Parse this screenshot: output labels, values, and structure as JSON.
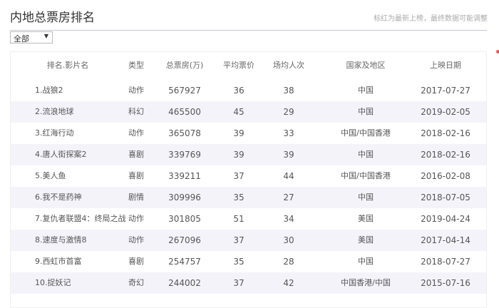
{
  "title": "内地总票房排名",
  "note": "标红为最新上榜，最终数据可能调整",
  "filter": {
    "selected": "全部"
  },
  "columns": [
    "排名.影片名",
    "类型",
    "总票房(万)",
    "平均票价",
    "场均人次",
    "国家及地区",
    "上映日期"
  ],
  "rows": [
    [
      "1.战狼2",
      "动作",
      "567927",
      "36",
      "38",
      "中国",
      "2017-07-27"
    ],
    [
      "2.流浪地球",
      "科幻",
      "465500",
      "45",
      "29",
      "中国",
      "2019-02-05"
    ],
    [
      "3.红海行动",
      "动作",
      "365078",
      "39",
      "33",
      "中国/中国香港",
      "2018-02-16"
    ],
    [
      "4.唐人街探案2",
      "喜剧",
      "339769",
      "39",
      "39",
      "中国",
      "2018-02-16"
    ],
    [
      "5.美人鱼",
      "喜剧",
      "339211",
      "37",
      "44",
      "中国/中国香港",
      "2016-02-08"
    ],
    [
      "6.我不是药神",
      "剧情",
      "309996",
      "35",
      "27",
      "中国",
      "2018-07-05"
    ],
    [
      "7.复仇者联盟4：终局之战",
      "动作",
      "301805",
      "51",
      "34",
      "美国",
      "2019-04-24"
    ],
    [
      "8.速度与激情8",
      "动作",
      "267096",
      "37",
      "30",
      "美国",
      "2017-04-14"
    ],
    [
      "9.西虹市首富",
      "喜剧",
      "254757",
      "35",
      "28",
      "中国",
      "2018-07-27"
    ],
    [
      "10.捉妖记",
      "奇幻",
      "244002",
      "37",
      "42",
      "中国香港/中国",
      "2015-07-16"
    ]
  ]
}
